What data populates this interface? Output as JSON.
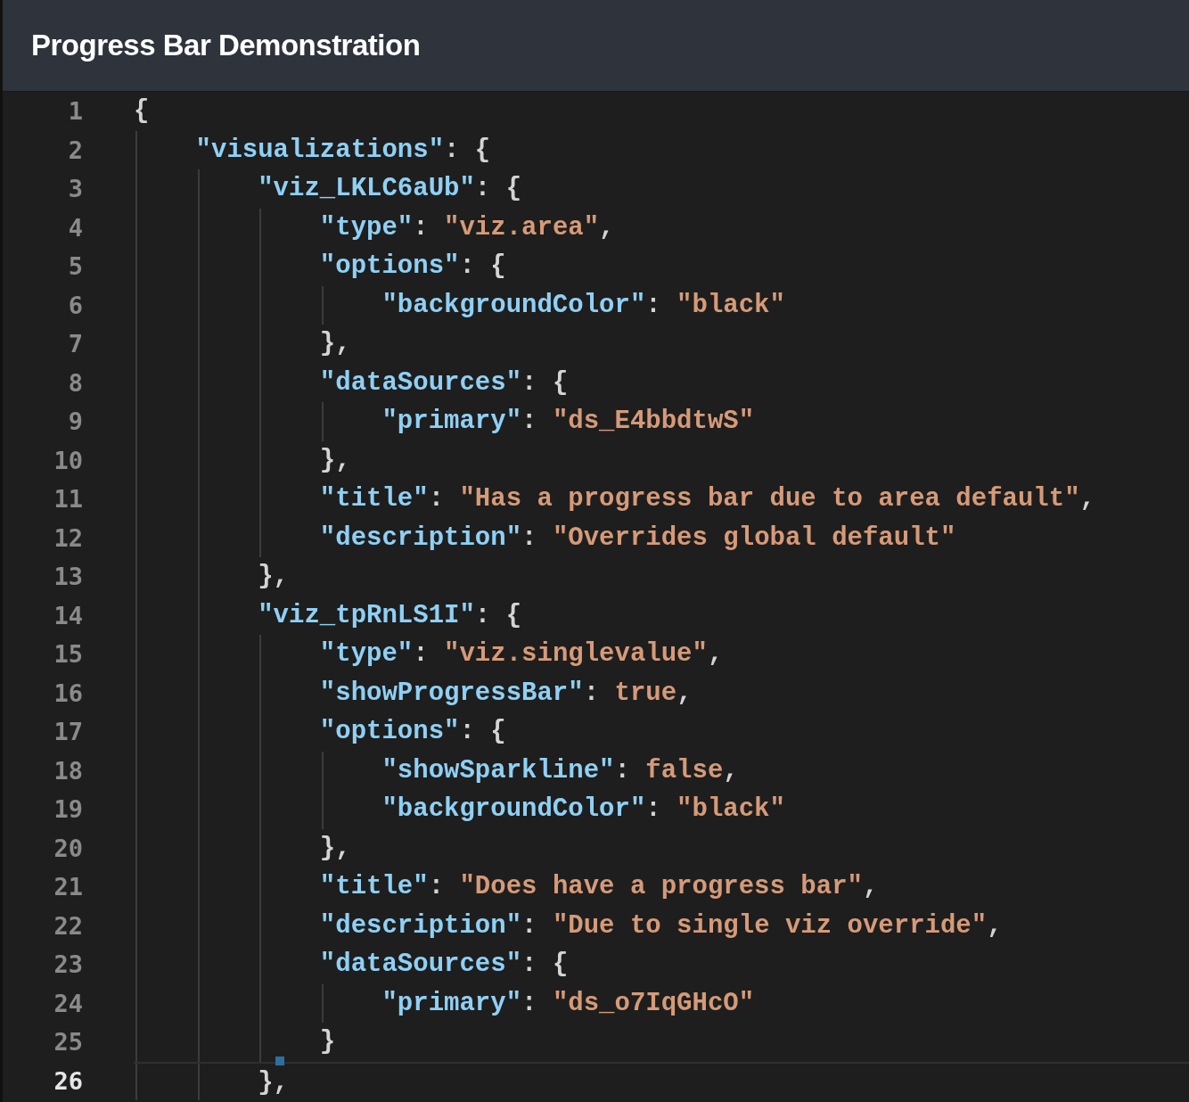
{
  "panel": {
    "title": "Progress Bar Demonstration"
  },
  "editor": {
    "lines": [
      {
        "number": "1",
        "selected": false,
        "tokens": [
          {
            "kind": "punct",
            "text": "{"
          }
        ],
        "children": [
          {
            "number": "2",
            "selected": false,
            "tokens": [
              {
                "kind": "key",
                "text": "\"visualizations\""
              },
              {
                "kind": "punct",
                "text": ": {"
              }
            ],
            "children": [
              {
                "number": "3",
                "selected": false,
                "tokens": [
                  {
                    "kind": "key",
                    "text": "\"viz_LKLC6aUb\""
                  },
                  {
                    "kind": "punct",
                    "text": ": {"
                  }
                ],
                "children": [
                  {
                    "number": "4",
                    "selected": false,
                    "tokens": [
                      {
                        "kind": "key",
                        "text": "\"type\""
                      },
                      {
                        "kind": "punct",
                        "text": ": "
                      },
                      {
                        "kind": "string",
                        "text": "\"viz.area\""
                      },
                      {
                        "kind": "punct",
                        "text": ","
                      }
                    ]
                  },
                  {
                    "number": "5",
                    "selected": false,
                    "tokens": [
                      {
                        "kind": "key",
                        "text": "\"options\""
                      },
                      {
                        "kind": "punct",
                        "text": ": {"
                      }
                    ],
                    "children": [
                      {
                        "number": "6",
                        "selected": false,
                        "tokens": [
                          {
                            "kind": "key",
                            "text": "\"backgroundColor\""
                          },
                          {
                            "kind": "punct",
                            "text": ": "
                          },
                          {
                            "kind": "string",
                            "text": "\"black\""
                          }
                        ]
                      }
                    ]
                  },
                  {
                    "number": "7",
                    "selected": false,
                    "tokens": [
                      {
                        "kind": "punct",
                        "text": "},"
                      }
                    ]
                  },
                  {
                    "number": "8",
                    "selected": false,
                    "tokens": [
                      {
                        "kind": "key",
                        "text": "\"dataSources\""
                      },
                      {
                        "kind": "punct",
                        "text": ": {"
                      }
                    ],
                    "children": [
                      {
                        "number": "9",
                        "selected": false,
                        "tokens": [
                          {
                            "kind": "key",
                            "text": "\"primary\""
                          },
                          {
                            "kind": "punct",
                            "text": ": "
                          },
                          {
                            "kind": "string",
                            "text": "\"ds_E4bbdtwS\""
                          }
                        ]
                      }
                    ]
                  },
                  {
                    "number": "10",
                    "selected": false,
                    "tokens": [
                      {
                        "kind": "punct",
                        "text": "},"
                      }
                    ]
                  },
                  {
                    "number": "11",
                    "selected": false,
                    "tokens": [
                      {
                        "kind": "key",
                        "text": "\"title\""
                      },
                      {
                        "kind": "punct",
                        "text": ": "
                      },
                      {
                        "kind": "string",
                        "text": "\"Has a progress bar due to area default\""
                      },
                      {
                        "kind": "punct",
                        "text": ","
                      }
                    ]
                  },
                  {
                    "number": "12",
                    "selected": false,
                    "tokens": [
                      {
                        "kind": "key",
                        "text": "\"description\""
                      },
                      {
                        "kind": "punct",
                        "text": ": "
                      },
                      {
                        "kind": "string",
                        "text": "\"Overrides global default\""
                      }
                    ]
                  }
                ]
              },
              {
                "number": "13",
                "selected": false,
                "tokens": [
                  {
                    "kind": "punct",
                    "text": "},"
                  }
                ]
              },
              {
                "number": "14",
                "selected": false,
                "tokens": [
                  {
                    "kind": "key",
                    "text": "\"viz_tpRnLS1I\""
                  },
                  {
                    "kind": "punct",
                    "text": ": {"
                  }
                ],
                "children": [
                  {
                    "number": "15",
                    "selected": false,
                    "tokens": [
                      {
                        "kind": "key",
                        "text": "\"type\""
                      },
                      {
                        "kind": "punct",
                        "text": ": "
                      },
                      {
                        "kind": "string",
                        "text": "\"viz.singlevalue\""
                      },
                      {
                        "kind": "punct",
                        "text": ","
                      }
                    ]
                  },
                  {
                    "number": "16",
                    "selected": false,
                    "tokens": [
                      {
                        "kind": "key",
                        "text": "\"showProgressBar\""
                      },
                      {
                        "kind": "punct",
                        "text": ": "
                      },
                      {
                        "kind": "literal",
                        "text": "true"
                      },
                      {
                        "kind": "punct",
                        "text": ","
                      }
                    ]
                  },
                  {
                    "number": "17",
                    "selected": false,
                    "tokens": [
                      {
                        "kind": "key",
                        "text": "\"options\""
                      },
                      {
                        "kind": "punct",
                        "text": ": {"
                      }
                    ],
                    "children": [
                      {
                        "number": "18",
                        "selected": false,
                        "tokens": [
                          {
                            "kind": "key",
                            "text": "\"showSparkline\""
                          },
                          {
                            "kind": "punct",
                            "text": ": "
                          },
                          {
                            "kind": "literal",
                            "text": "false"
                          },
                          {
                            "kind": "punct",
                            "text": ","
                          }
                        ]
                      },
                      {
                        "number": "19",
                        "selected": false,
                        "tokens": [
                          {
                            "kind": "key",
                            "text": "\"backgroundColor\""
                          },
                          {
                            "kind": "punct",
                            "text": ": "
                          },
                          {
                            "kind": "string",
                            "text": "\"black\""
                          }
                        ]
                      }
                    ]
                  },
                  {
                    "number": "20",
                    "selected": false,
                    "tokens": [
                      {
                        "kind": "punct",
                        "text": "},"
                      }
                    ]
                  },
                  {
                    "number": "21",
                    "selected": false,
                    "tokens": [
                      {
                        "kind": "key",
                        "text": "\"title\""
                      },
                      {
                        "kind": "punct",
                        "text": ": "
                      },
                      {
                        "kind": "string",
                        "text": "\"Does have a progress bar\""
                      },
                      {
                        "kind": "punct",
                        "text": ","
                      }
                    ]
                  },
                  {
                    "number": "22",
                    "selected": false,
                    "tokens": [
                      {
                        "kind": "key",
                        "text": "\"description\""
                      },
                      {
                        "kind": "punct",
                        "text": ": "
                      },
                      {
                        "kind": "string",
                        "text": "\"Due to single viz override\""
                      },
                      {
                        "kind": "punct",
                        "text": ","
                      }
                    ]
                  },
                  {
                    "number": "23",
                    "selected": false,
                    "tokens": [
                      {
                        "kind": "key",
                        "text": "\"dataSources\""
                      },
                      {
                        "kind": "punct",
                        "text": ": {"
                      }
                    ],
                    "children": [
                      {
                        "number": "24",
                        "selected": false,
                        "tokens": [
                          {
                            "kind": "key",
                            "text": "\"primary\""
                          },
                          {
                            "kind": "punct",
                            "text": ": "
                          },
                          {
                            "kind": "string",
                            "text": "\"ds_o7IqGHcO\""
                          }
                        ]
                      }
                    ]
                  },
                  {
                    "number": "25",
                    "selected": false,
                    "tokens": [
                      {
                        "kind": "punct",
                        "text": "}"
                      }
                    ]
                  }
                ]
              },
              {
                "number": "26",
                "selected": true,
                "tokens": [
                  {
                    "kind": "punct",
                    "text": "},"
                  }
                ]
              }
            ]
          }
        ]
      }
    ]
  }
}
